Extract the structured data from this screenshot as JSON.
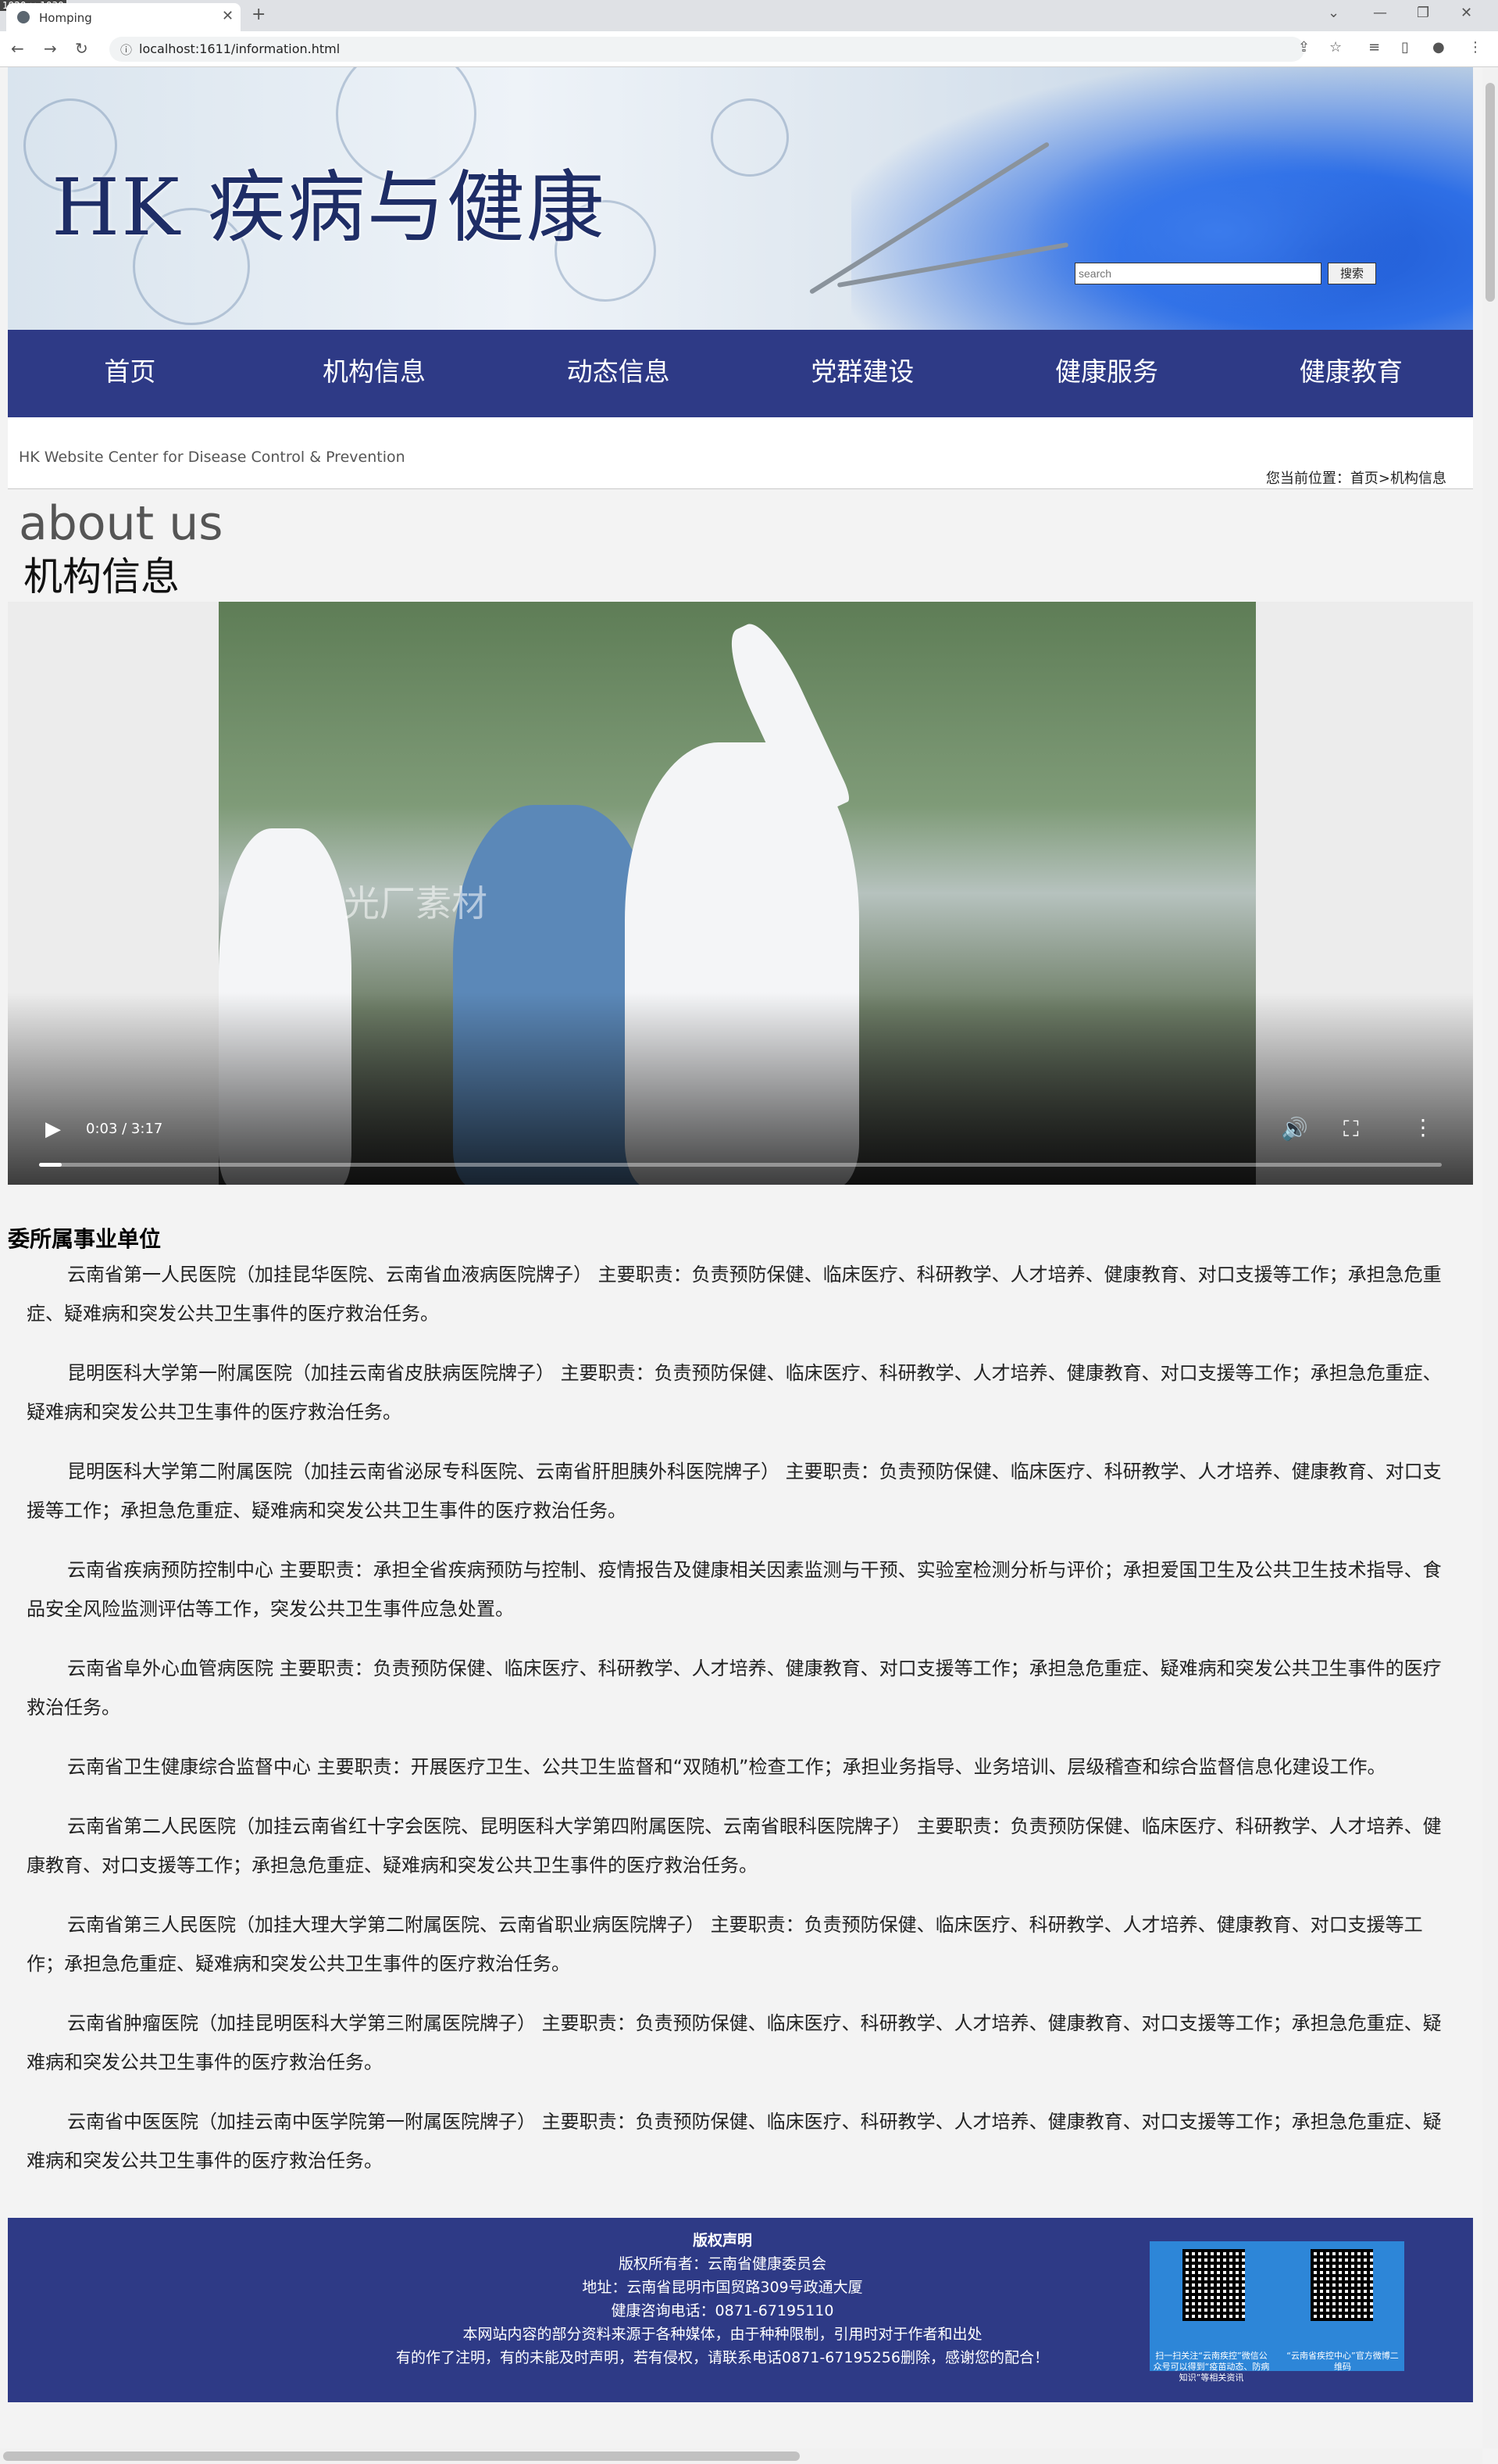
{
  "browser": {
    "dims_label": "1920 × 1030",
    "tab_title": "Homping",
    "url": "localhost:1611/information.html"
  },
  "banner": {
    "title": "HK 疾病与健康",
    "search_placeholder": "search",
    "search_button": "搜索"
  },
  "nav": {
    "items": [
      "首页",
      "机构信息",
      "动态信息",
      "党群建设",
      "健康服务",
      "健康教育"
    ]
  },
  "breadcrumb": {
    "site_subtitle": "HK Website Center for Disease Control & Prevention",
    "location": "您当前位置：首页>机构信息"
  },
  "page": {
    "about": "about us",
    "title": "机构信息"
  },
  "video": {
    "time": "0:03 / 3:17",
    "watermark": "光厂素材",
    "progress_fraction": 0.016
  },
  "units": {
    "title": "委所属事业单位",
    "paragraphs": [
      "云南省第一人民医院（加挂昆华医院、云南省血液病医院牌子） 主要职责：负责预防保健、临床医疗、科研教学、人才培养、健康教育、对口支援等工作；承担急危重症、疑难病和突发公共卫生事件的医疗救治任务。",
      "昆明医科大学第一附属医院（加挂云南省皮肤病医院牌子） 主要职责：负责预防保健、临床医疗、科研教学、人才培养、健康教育、对口支援等工作；承担急危重症、疑难病和突发公共卫生事件的医疗救治任务。",
      "昆明医科大学第二附属医院（加挂云南省泌尿专科医院、云南省肝胆胰外科医院牌子） 主要职责：负责预防保健、临床医疗、科研教学、人才培养、健康教育、对口支援等工作；承担急危重症、疑难病和突发公共卫生事件的医疗救治任务。",
      "云南省疾病预防控制中心 主要职责：承担全省疾病预防与控制、疫情报告及健康相关因素监测与干预、实验室检测分析与评价；承担爱国卫生及公共卫生技术指导、食品安全风险监测评估等工作，突发公共卫生事件应急处置。",
      "云南省阜外心血管病医院 主要职责：负责预防保健、临床医疗、科研教学、人才培养、健康教育、对口支援等工作；承担急危重症、疑难病和突发公共卫生事件的医疗救治任务。",
      "云南省卫生健康综合监督中心 主要职责：开展医疗卫生、公共卫生监督和“双随机”检查工作；承担业务指导、业务培训、层级稽查和综合监督信息化建设工作。",
      "云南省第二人民医院（加挂云南省红十字会医院、昆明医科大学第四附属医院、云南省眼科医院牌子） 主要职责：负责预防保健、临床医疗、科研教学、人才培养、健康教育、对口支援等工作；承担急危重症、疑难病和突发公共卫生事件的医疗救治任务。",
      "云南省第三人民医院（加挂大理大学第二附属医院、云南省职业病医院牌子） 主要职责：负责预防保健、临床医疗、科研教学、人才培养、健康教育、对口支援等工作；承担急危重症、疑难病和突发公共卫生事件的医疗救治任务。",
      "云南省肿瘤医院（加挂昆明医科大学第三附属医院牌子） 主要职责：负责预防保健、临床医疗、科研教学、人才培养、健康教育、对口支援等工作；承担急危重症、疑难病和突发公共卫生事件的医疗救治任务。",
      "云南省中医医院（加挂云南中医学院第一附属医院牌子） 主要职责：负责预防保健、临床医疗、科研教学、人才培养、健康教育、对口支援等工作；承担急危重症、疑难病和突发公共卫生事件的医疗救治任务。"
    ]
  },
  "footer": {
    "title": "版权声明",
    "owner": "版权所有者：云南省健康委员会",
    "address": "地址：云南省昆明市国贸路309号政通大厦",
    "phone": "健康咨询电话：0871-67195110",
    "notice1": "本网站内容的部分资料来源于各种媒体，由于种种限制，引用时对于作者和出处",
    "notice2": "有的作了注明，有的未能及时声明，若有侵权，请联系电话0871-67195256删除，感谢您的配合！",
    "qr_caption_left": "扫一扫关注“云南疾控”微信公众号可以得到“疫苗动态、防病知识”等相关资讯",
    "qr_caption_right": "“云南省疾控中心”官方微博二维码"
  }
}
